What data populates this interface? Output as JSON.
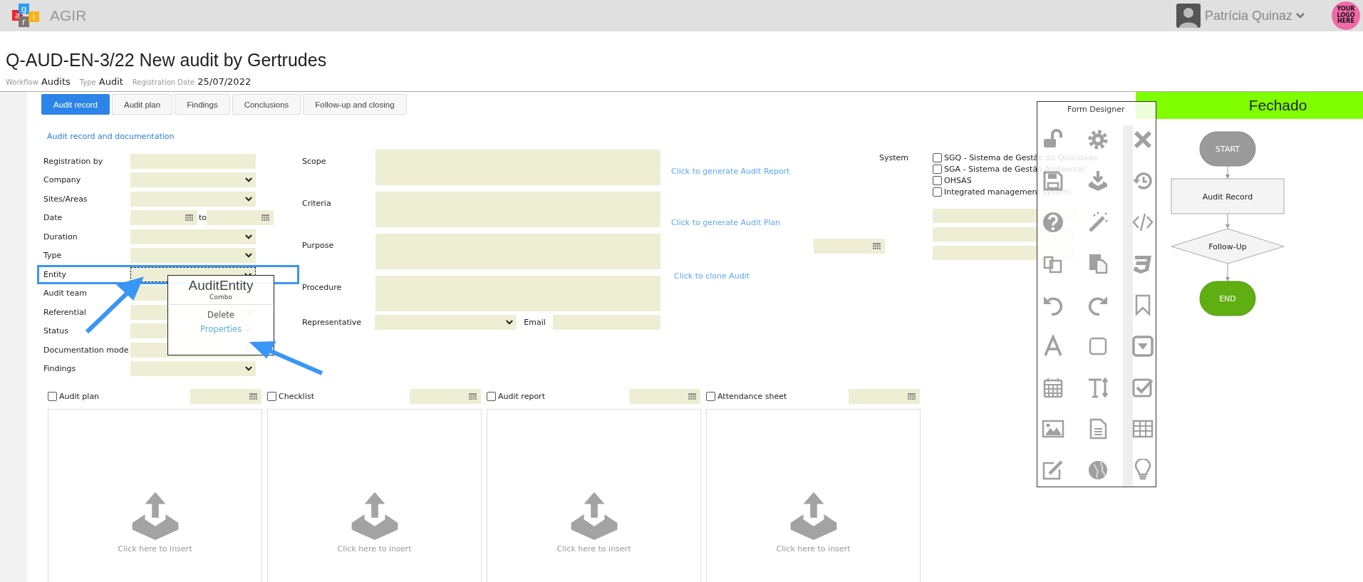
{
  "app": {
    "logo_letters": [
      "a",
      "g",
      "r",
      "i"
    ],
    "name": "AGIR",
    "user": "Patrícia Quinaz",
    "company_logo": "YOUR LOGO HERE"
  },
  "record": {
    "title": "Q-AUD-EN-3/22 New audit by Gertrudes",
    "meta": [
      {
        "label": "Workflow",
        "value": "Audits"
      },
      {
        "label": "Type",
        "value": "Audit"
      },
      {
        "label": "Registration Date",
        "value": "25/07/2022"
      }
    ]
  },
  "tabs": [
    {
      "label": "Audit record",
      "selected": true
    },
    {
      "label": "Audit plan",
      "selected": false
    },
    {
      "label": "Findings",
      "selected": false
    },
    {
      "label": "Conclusions",
      "selected": false
    },
    {
      "label": "Follow-up and closing",
      "selected": false
    }
  ],
  "section_title": "Audit record and documentation",
  "left_fields": [
    {
      "label": "Registration by",
      "kind": "text",
      "selected": false
    },
    {
      "label": "Company",
      "kind": "select",
      "selected": false
    },
    {
      "label": "Sites/Areas",
      "kind": "select",
      "selected": false
    },
    {
      "label": "Date",
      "kind": "daterange",
      "to": "to",
      "selected": false
    },
    {
      "label": "Duration",
      "kind": "select",
      "selected": false
    },
    {
      "label": "Type",
      "kind": "select",
      "selected": false
    },
    {
      "label": "Entity",
      "kind": "select",
      "selected": true
    },
    {
      "label": "Audit team",
      "kind": "text",
      "selected": false
    },
    {
      "label": "Referential",
      "kind": "select",
      "selected": false
    },
    {
      "label": "Status",
      "kind": "select",
      "selected": false
    },
    {
      "label": "Documentation mode",
      "kind": "select",
      "selected": false
    },
    {
      "label": "Findings",
      "kind": "select",
      "selected": false
    }
  ],
  "middle_fields": [
    {
      "label": "Scope"
    },
    {
      "label": "Criteria"
    },
    {
      "label": "Purpose"
    },
    {
      "label": "Procedure"
    }
  ],
  "links": [
    "Click to generate Audit Report",
    "Click to generate Audit Plan",
    "Click to clone Audit"
  ],
  "representative": {
    "label": "Representative",
    "email_label": "Email"
  },
  "system": {
    "label": "System",
    "options": [
      {
        "label": "SGQ - Sistema de Gestão da Qualidade",
        "checked": false
      },
      {
        "label": "SGA - Sistema de Gestão Ambiental",
        "checked": false
      },
      {
        "label": "OHSAS",
        "checked": false
      },
      {
        "label": "Integrated management system",
        "checked": false
      }
    ]
  },
  "context_menu": {
    "title": "AuditEntity",
    "subtitle": "Combo",
    "items": [
      {
        "label": "Delete",
        "kind": "action"
      },
      {
        "label": "Properties",
        "kind": "link"
      }
    ]
  },
  "attachments": [
    {
      "label": "Audit plan",
      "checked": false,
      "prompt": "Click here to insert"
    },
    {
      "label": "Checklist",
      "checked": false,
      "prompt": "Click here to insert"
    },
    {
      "label": "Audit report",
      "checked": false,
      "prompt": "Click here to insert"
    },
    {
      "label": "Attendance sheet",
      "checked": false,
      "prompt": "Click here to insert"
    }
  ],
  "designer": {
    "title": "Form Designer"
  },
  "status": {
    "label": "Fechado"
  },
  "flow": [
    {
      "label": "START",
      "kind": "start"
    },
    {
      "label": "Audit Record",
      "kind": "step"
    },
    {
      "label": "Follow-Up",
      "kind": "decision"
    },
    {
      "label": "END",
      "kind": "end"
    }
  ]
}
